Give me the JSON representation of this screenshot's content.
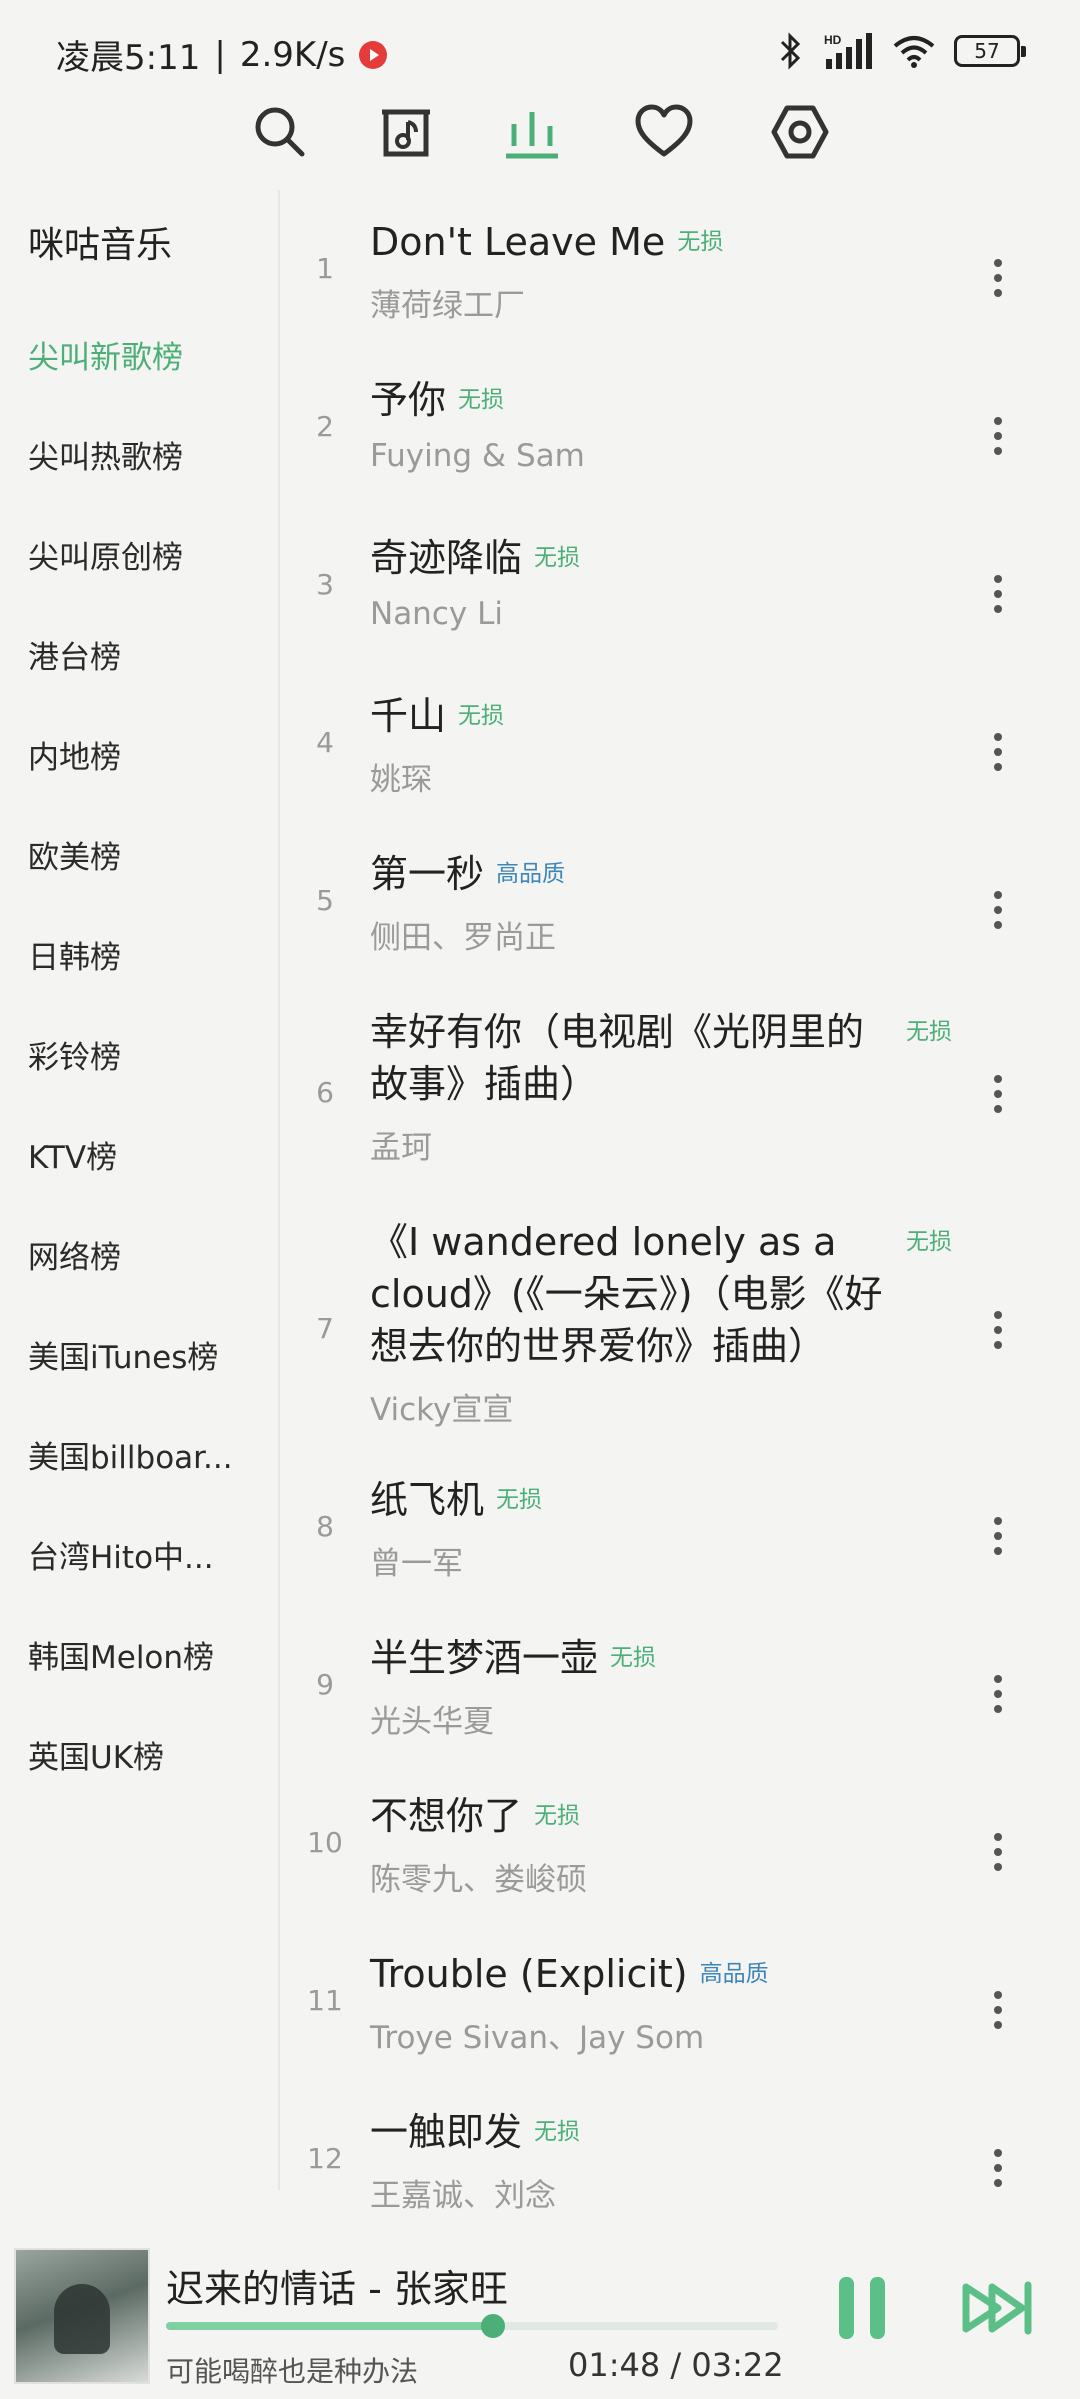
{
  "status_bar": {
    "time": "凌晨5:11",
    "separator": "|",
    "speed": "2.9K/s",
    "battery": "57",
    "icons": [
      "record-icon",
      "bluetooth-icon",
      "signal-icon",
      "wifi-icon",
      "battery-icon"
    ]
  },
  "toolbar": {
    "icons": [
      "search-icon",
      "music-file-icon",
      "chart-bars-icon",
      "heart-icon",
      "settings-hex-icon"
    ],
    "active_index": 2,
    "accent_color": "#4caf77"
  },
  "sidebar": {
    "header": "咪咕音乐",
    "items": [
      {
        "label": "尖叫新歌榜"
      },
      {
        "label": "尖叫热歌榜"
      },
      {
        "label": "尖叫原创榜"
      },
      {
        "label": "港台榜"
      },
      {
        "label": "内地榜"
      },
      {
        "label": "欧美榜"
      },
      {
        "label": "日韩榜"
      },
      {
        "label": "彩铃榜"
      },
      {
        "label": "KTV榜"
      },
      {
        "label": "网络榜"
      },
      {
        "label": "美国iTunes榜"
      },
      {
        "label": "美国billboar..."
      },
      {
        "label": "台湾Hito中..."
      },
      {
        "label": "韩国Melon榜"
      },
      {
        "label": "英国UK榜"
      }
    ],
    "active_index": 0
  },
  "songs": [
    {
      "num": "1",
      "title": "Don't Leave Me",
      "badge": "无损",
      "badge_type": "lossless",
      "artist": "薄荷绿工厂"
    },
    {
      "num": "2",
      "title": "予你",
      "badge": "无损",
      "badge_type": "lossless",
      "artist": "Fuying & Sam"
    },
    {
      "num": "3",
      "title": "奇迹降临",
      "badge": "无损",
      "badge_type": "lossless",
      "artist": "Nancy Li"
    },
    {
      "num": "4",
      "title": "千山",
      "badge": "无损",
      "badge_type": "lossless",
      "artist": "姚琛"
    },
    {
      "num": "5",
      "title": "第一秒",
      "badge": "高品质",
      "badge_type": "hq",
      "artist": "侧田、罗尚正"
    },
    {
      "num": "6",
      "title_lines": [
        "幸好有你（电视剧《光阴里的",
        "故事》插曲）"
      ],
      "badge": "无损",
      "badge_type": "lossless",
      "artist": "孟珂"
    },
    {
      "num": "7",
      "title_lines": [
        "《I wandered lonely as a",
        "cloud》(《一朵云》)（电影《好",
        "想去你的世界爱你》插曲）"
      ],
      "badge": "无损",
      "badge_type": "lossless",
      "artist": "Vicky宣宣"
    },
    {
      "num": "8",
      "title": "纸飞机",
      "badge": "无损",
      "badge_type": "lossless",
      "artist": "曾一军"
    },
    {
      "num": "9",
      "title": "半生梦酒一壶",
      "badge": "无损",
      "badge_type": "lossless",
      "artist": "光头华夏"
    },
    {
      "num": "10",
      "title": "不想你了",
      "badge": "无损",
      "badge_type": "lossless",
      "artist": "陈零九、娄峻硕"
    },
    {
      "num": "11",
      "title": "Trouble (Explicit)",
      "badge": "高品质",
      "badge_type": "hq",
      "artist": "Troye Sivan、Jay Som"
    },
    {
      "num": "12",
      "title": "一触即发",
      "badge": "无损",
      "badge_type": "lossless",
      "artist": "王嘉诚、刘念"
    }
  ],
  "player": {
    "title": "迟来的情话 - 张家旺",
    "lyric": "可能喝醉也是种办法",
    "current_time": "01:48",
    "time_separator": " / ",
    "total_time": "03:22",
    "progress": 0.535,
    "icons": [
      "album-cover",
      "pause-icon",
      "next-icon"
    ]
  }
}
